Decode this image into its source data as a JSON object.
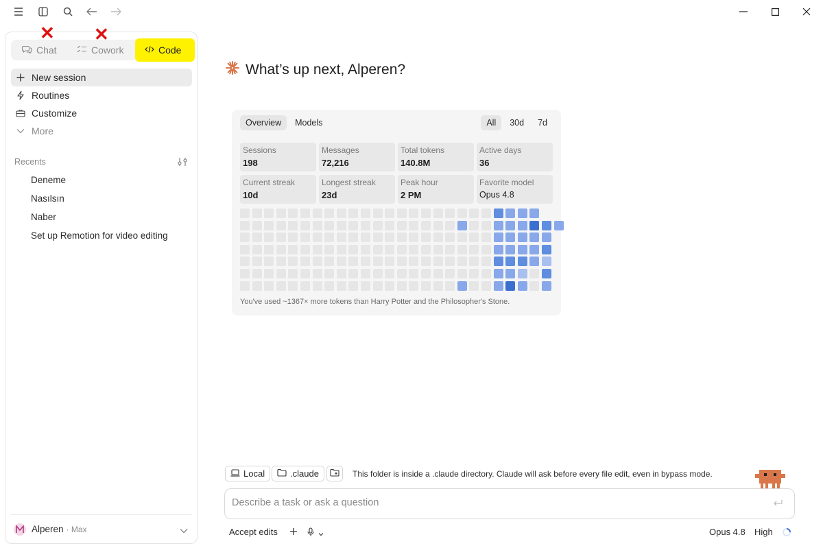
{
  "modes": {
    "chat_label": "Chat",
    "cowork_label": "Cowork",
    "code_label": "Code",
    "highlight_color": "#fff200",
    "annotation_color": "#e01010"
  },
  "nav": {
    "new_session": "New session",
    "routines": "Routines",
    "customize": "Customize",
    "more": "More"
  },
  "recents": {
    "label": "Recents",
    "items": [
      "Deneme",
      "Nasılsın",
      "Naber",
      "Set up Remotion for video editing"
    ]
  },
  "user": {
    "name": "Alperen",
    "plan": "· Max"
  },
  "greeting": "What’s up next, Alperen?",
  "stats": {
    "tabs": [
      "Overview",
      "Models"
    ],
    "active_tab": "Overview",
    "ranges": [
      "All",
      "30d",
      "7d"
    ],
    "active_range": "All",
    "boxes": [
      {
        "label": "Sessions",
        "value": "198"
      },
      {
        "label": "Messages",
        "value": "72,216"
      },
      {
        "label": "Total tokens",
        "value": "140.8M"
      },
      {
        "label": "Active days",
        "value": "36"
      },
      {
        "label": "Current streak",
        "value": "10d"
      },
      {
        "label": "Longest streak",
        "value": "23d"
      },
      {
        "label": "Peak hour",
        "value": "2 PM"
      },
      {
        "label": "Favorite model",
        "value": "Opus 4.8"
      }
    ],
    "note": "You've used ~1367× more tokens than Harry Potter and the Philosopher's Stone.",
    "heatmap_colors": [
      "#e6e6e6",
      "#a9c0ef",
      "#88a8ea",
      "#5f8ddf",
      "#3a6fd0"
    ],
    "heatmap_rows": [
      [
        0,
        0,
        0,
        0,
        0,
        0,
        0,
        0,
        0,
        0,
        0,
        0,
        0,
        0,
        0,
        0,
        0,
        0,
        0,
        0,
        0,
        3,
        2,
        2,
        2
      ],
      [
        0,
        0,
        0,
        0,
        0,
        0,
        0,
        0,
        0,
        0,
        0,
        0,
        0,
        0,
        0,
        0,
        0,
        0,
        2,
        0,
        0,
        2,
        2,
        2,
        4,
        3,
        2
      ],
      [
        0,
        0,
        0,
        0,
        0,
        0,
        0,
        0,
        0,
        0,
        0,
        0,
        0,
        0,
        0,
        0,
        0,
        0,
        0,
        0,
        0,
        2,
        2,
        2,
        2,
        2
      ],
      [
        0,
        0,
        0,
        0,
        0,
        0,
        0,
        0,
        0,
        0,
        0,
        0,
        0,
        0,
        0,
        0,
        0,
        0,
        0,
        0,
        0,
        2,
        2,
        2,
        2,
        3
      ],
      [
        0,
        0,
        0,
        0,
        0,
        0,
        0,
        0,
        0,
        0,
        0,
        0,
        0,
        0,
        0,
        0,
        0,
        0,
        0,
        0,
        0,
        3,
        3,
        3,
        2,
        1
      ],
      [
        0,
        0,
        0,
        0,
        0,
        0,
        0,
        0,
        0,
        0,
        0,
        0,
        0,
        0,
        0,
        0,
        0,
        0,
        0,
        0,
        0,
        2,
        2,
        1,
        0,
        3
      ],
      [
        0,
        0,
        0,
        0,
        0,
        0,
        0,
        0,
        0,
        0,
        0,
        0,
        0,
        0,
        0,
        0,
        0,
        0,
        2,
        0,
        0,
        2,
        4,
        2,
        0,
        2
      ]
    ]
  },
  "composer": {
    "env_label": "Local",
    "folder_label": ".claude",
    "notice": "This folder is inside a .claude directory. Claude will ask before every file edit, even in bypass mode.",
    "placeholder": "Describe a task or ask a question",
    "accept_edits": "Accept edits",
    "model": "Opus 4.8",
    "effort": "High"
  }
}
